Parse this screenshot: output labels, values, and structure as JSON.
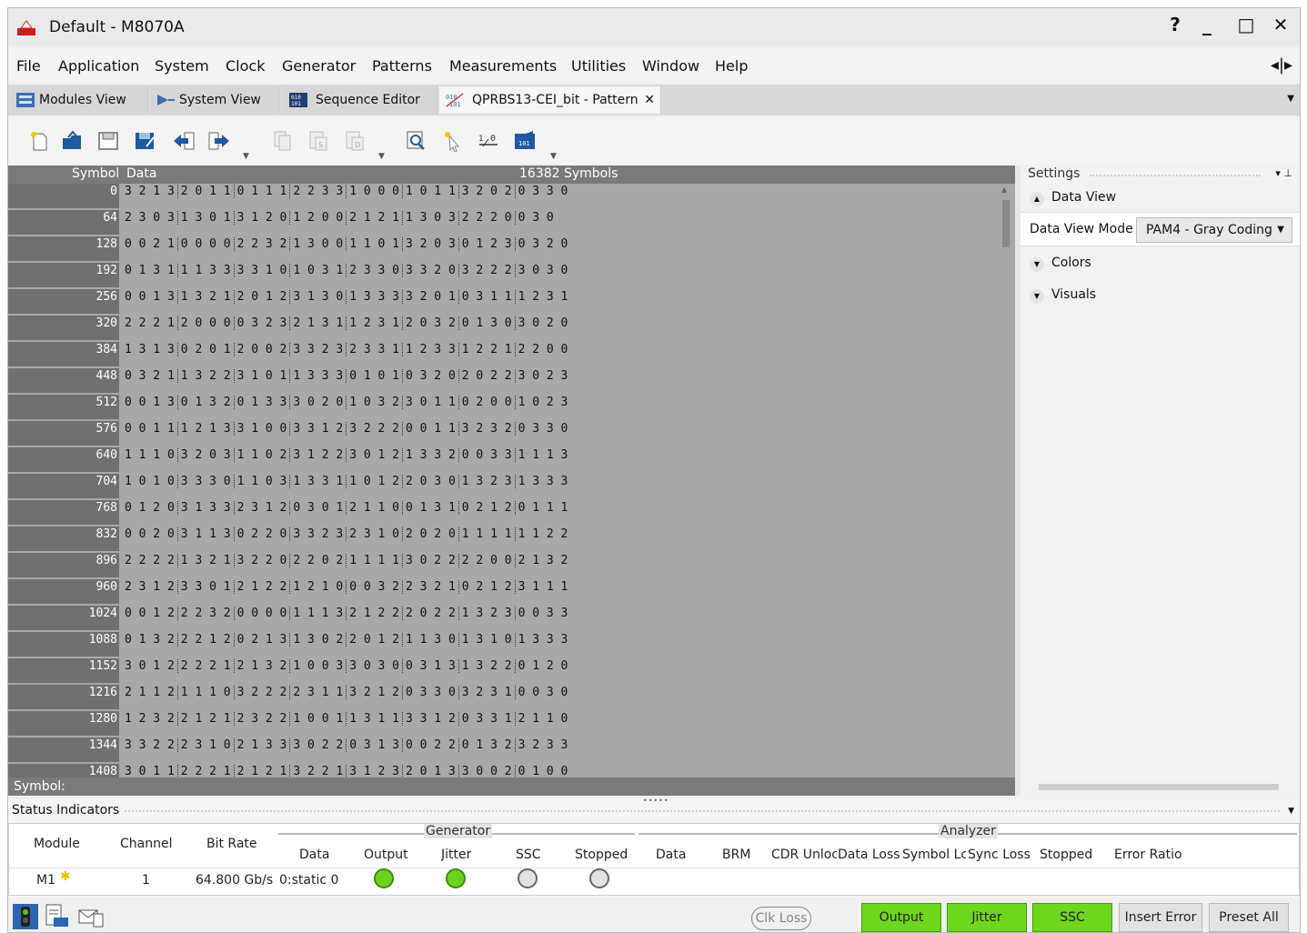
{
  "window": {
    "title": "Default - M8070A",
    "help": "?",
    "minimize": "_",
    "maximize": "□",
    "close": "✕"
  },
  "menu": [
    "File",
    "Application",
    "System",
    "Clock",
    "Generator",
    "Patterns",
    "Measurements",
    "Utilities",
    "Window",
    "Help"
  ],
  "tabs": [
    {
      "label": "Modules View",
      "active": false
    },
    {
      "label": "System View",
      "active": false
    },
    {
      "label": "Sequence Editor",
      "active": false
    },
    {
      "label": "QPRBS13-CEI_bit - Pattern",
      "active": true,
      "close": "✕"
    }
  ],
  "editor": {
    "header_symbol": "Symbol",
    "header_data": "Data",
    "symbol_count": "16382 Symbols",
    "footer_label": "Symbol:",
    "rows": [
      {
        "offset": "0",
        "data": "3213201101112233100010113202 0330"
      },
      {
        "offset": "64",
        "data": "2303130131201200212113032220030"
      },
      {
        "offset": "128",
        "data": "0021000022321300110132030123 0320"
      },
      {
        "offset": "192",
        "data": "0131113333101031233033203222 3030"
      },
      {
        "offset": "256",
        "data": "0013132120123130133332010311 1231"
      },
      {
        "offset": "320",
        "data": "2221200003232131123120320130 3020"
      },
      {
        "offset": "384",
        "data": "1313020120023323233112331221 2200"
      },
      {
        "offset": "448",
        "data": "0321132231011333010103202022 3023"
      },
      {
        "offset": "512",
        "data": "0013013201333020103230110200 1023"
      },
      {
        "offset": "576",
        "data": "0011121331003312322200113232 0330"
      },
      {
        "offset": "640",
        "data": "1110320311023122301213320033 1113"
      },
      {
        "offset": "704",
        "data": "1010333011031331101220301323 1333"
      },
      {
        "offset": "768",
        "data": "0120313323120301211001310212 0111"
      },
      {
        "offset": "832",
        "data": "0020311302203323231020201111 1122"
      },
      {
        "offset": "896",
        "data": "2222132132202202111130222200 2132"
      },
      {
        "offset": "960",
        "data": "2312330121221210003223210212 3111"
      },
      {
        "offset": "1024",
        "data": "0012223200001113212220221323 0033"
      },
      {
        "offset": "1088",
        "data": "0132221202131302201211301310 1333"
      },
      {
        "offset": "1152",
        "data": "3012222121321003303003131322 0120"
      },
      {
        "offset": "1216",
        "data": "2112111032222311321203303231 0030"
      },
      {
        "offset": "1280",
        "data": "1232212123221001131133120331 2110"
      },
      {
        "offset": "1344",
        "data": "3322231021333022031300220132 3233"
      },
      {
        "offset": "1408",
        "data": "3011222121213221312320133002 0100"
      }
    ]
  },
  "settings": {
    "title": "Settings",
    "pin": "▾ ⊥",
    "sections": {
      "data_view": "Data View",
      "colors": "Colors",
      "visuals": "Visuals"
    },
    "data_view_mode_label": "Data View Mode",
    "data_view_mode_value": "PAM4 - Gray Coding"
  },
  "status": {
    "title": "Status Indicators",
    "columns": {
      "module": "Module",
      "channel": "Channel",
      "bit_rate": "Bit Rate"
    },
    "generator": {
      "label": "Generator",
      "cols": [
        "Data",
        "Output",
        "Jitter",
        "SSC",
        "Stopped"
      ]
    },
    "analyzer": {
      "label": "Analyzer",
      "cols": [
        "Data",
        "BRM",
        "CDR Unloc",
        "Data Loss",
        "Symbol Lc",
        "Sync Loss",
        "Stopped",
        "Error Ratio"
      ]
    },
    "row": {
      "module": "M1",
      "channel": "1",
      "bit_rate": "64.800 Gb/s",
      "gen_data": "0:static 0"
    },
    "leds": {
      "output": "on",
      "jitter": "on",
      "ssc": "off",
      "stopped": "off"
    }
  },
  "bottom": {
    "clk_loss": "Clk Loss",
    "buttons": [
      "Output",
      "Jitter",
      "SSC"
    ],
    "insert_error": "Insert Error",
    "preset_all": "Preset All"
  },
  "colors": {
    "green": "#6ed61c",
    "grid_bg": "#a8a8a8",
    "symbol_col": "#707070"
  }
}
